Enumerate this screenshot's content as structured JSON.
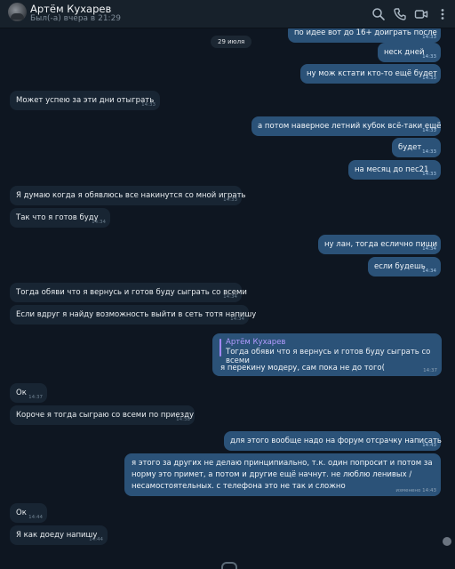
{
  "header": {
    "name": "Артём Кухарев",
    "status": "Был(-а) вчера в 21:29",
    "search_icon": "search-icon",
    "phone_icon": "phone-icon",
    "video_icon": "video-icon",
    "more_icon": "more-vertical-icon"
  },
  "chat": {
    "date": "29 июля",
    "messages": [
      {
        "dir": "out",
        "text": "по идее вот до 16+ доиграть после",
        "time": "14:33"
      },
      {
        "dir": "out",
        "text": "неск дней",
        "time": "14:33"
      },
      {
        "dir": "out",
        "text": "ну мож кстати кто-то ещё будет",
        "time": "14:33"
      },
      {
        "dir": "in",
        "text": "Может успею за эти дни отыграть",
        "time": "14:33"
      },
      {
        "dir": "out",
        "text": "а потом наверное летний кубок всё-таки ещё",
        "time": "14:33"
      },
      {
        "dir": "out",
        "text": "будет",
        "time": "14:33"
      },
      {
        "dir": "out",
        "text": "на месяц до пес21",
        "time": "14:33"
      },
      {
        "dir": "in",
        "text": "Я думаю когда я обявлюсь все накинутся со мной играть",
        "time": "14:33"
      },
      {
        "dir": "in",
        "text": "Так что я готов буду",
        "time": "14:34"
      },
      {
        "dir": "out",
        "text": "ну лан, тогда еслично пиши",
        "time": "14:34"
      },
      {
        "dir": "out",
        "text": "если будешь",
        "time": "14:34"
      },
      {
        "dir": "in",
        "text": "Тогда обяви что я вернусь и готов буду сыграть со всеми",
        "time": "14:34"
      },
      {
        "dir": "in",
        "text": "Если вдруг я найду возможность выйти в сеть тотя напишу",
        "time": "14:34"
      },
      {
        "dir": "in",
        "text": "Ок",
        "time": "14:37"
      },
      {
        "dir": "in",
        "text": "Короче я тогда сыграю со всеми по приезду",
        "time": "14:38"
      },
      {
        "dir": "out",
        "text": "для этого вообще надо на форум отсрачку написать",
        "time": "14:43"
      },
      {
        "dir": "in",
        "text": "Ок",
        "time": "14:44"
      },
      {
        "dir": "in",
        "text": "Я как доеду напишу",
        "time": "14:44"
      }
    ],
    "reply": {
      "author": "Артём Кухарев",
      "quote": "Тогда обяви что я вернусь и готов буду сыграть со всеми",
      "text": "я перекину модеру, сам пока не до того(",
      "time": "14:37"
    },
    "long": {
      "text": "я этого за других не делаю принципиально, т.к. один попросит и потом за норму это примет, а потом и другие ещё начнут. не люблю ленивых / несамостоятельных. с телефона это не так и сложно",
      "time": "изменено 14:43"
    }
  }
}
